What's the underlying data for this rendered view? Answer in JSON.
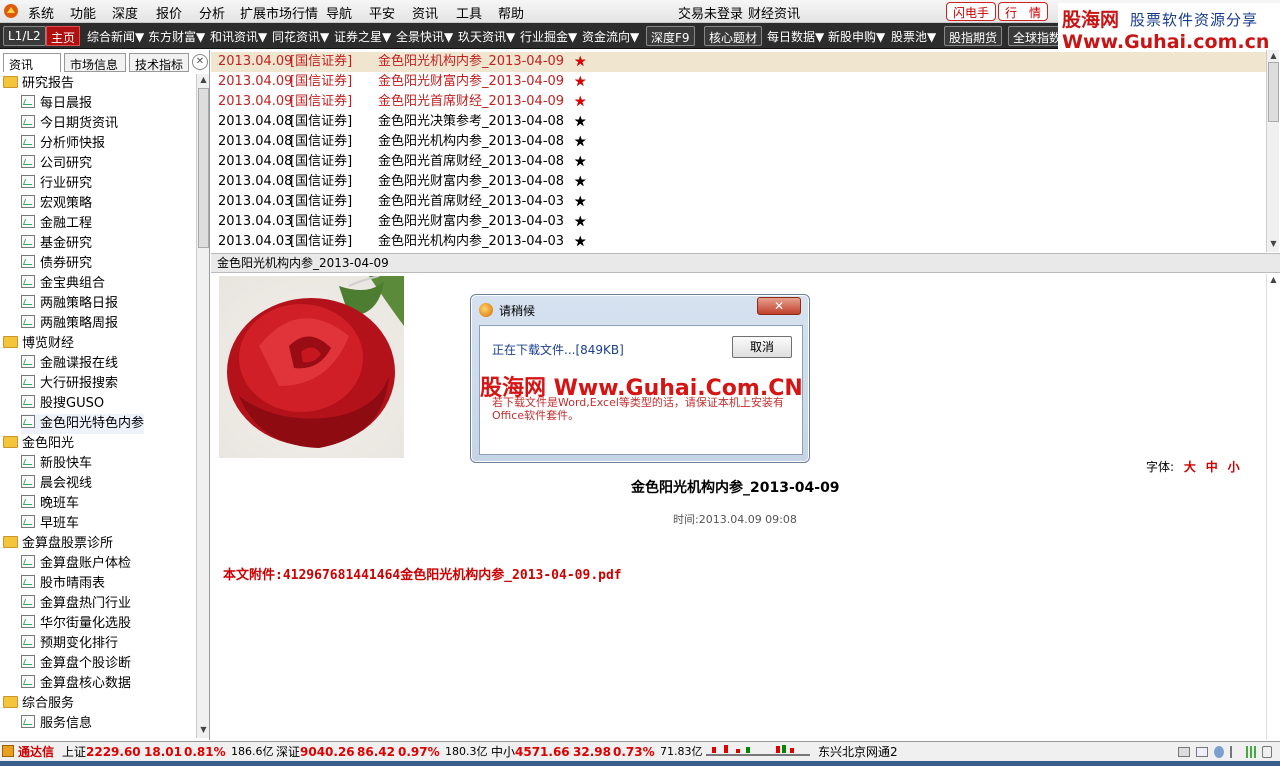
{
  "menubar": {
    "items": [
      "系统",
      "功能",
      "深度",
      "报价",
      "分析",
      "扩展市场行情",
      "导航",
      "平安",
      "资讯",
      "工具",
      "帮助"
    ],
    "trade_status": "交易未登录",
    "finance_news": "财经资讯",
    "flash_btn": "闪电手",
    "quote_btn": "行　情"
  },
  "toolbar": {
    "l1l2": "L1/L2",
    "home": "主页",
    "items": [
      "综合新闻▼",
      "东方财富▼",
      "和讯资讯▼",
      "同花资讯▼",
      "证券之星▼",
      "全景快讯▼",
      "玖天资讯▼",
      "行业掘金▼",
      "资金流向▼"
    ],
    "depth": "深度F9",
    "core": "核心题材",
    "daily": "每日数据▼",
    "ipo": "新股申购▼",
    "pool": "股票池▼",
    "futures": "股指期货",
    "global": "全球指数"
  },
  "watermark_logo": {
    "line1": "股海网",
    "line1b": "股票软件资源分享",
    "line2": "Www.Guhai.com.cn"
  },
  "left_tabs": [
    "资讯",
    "市场信息",
    "技术指标"
  ],
  "left_close": "✕",
  "tree": [
    {
      "type": "folder",
      "label": "研究报告"
    },
    {
      "type": "leaf",
      "label": "每日晨报"
    },
    {
      "type": "leaf",
      "label": "今日期货资讯"
    },
    {
      "type": "leaf",
      "label": "分析师快报"
    },
    {
      "type": "leaf",
      "label": "公司研究"
    },
    {
      "type": "leaf",
      "label": "行业研究"
    },
    {
      "type": "leaf",
      "label": "宏观策略"
    },
    {
      "type": "leaf",
      "label": "金融工程"
    },
    {
      "type": "leaf",
      "label": "基金研究"
    },
    {
      "type": "leaf",
      "label": "债券研究"
    },
    {
      "type": "leaf",
      "label": "金宝典组合"
    },
    {
      "type": "leaf",
      "label": "两融策略日报"
    },
    {
      "type": "leaf",
      "label": "两融策略周报"
    },
    {
      "type": "folder",
      "label": "博览财经"
    },
    {
      "type": "leaf",
      "label": "金融谍报在线"
    },
    {
      "type": "leaf",
      "label": "大行研报搜索"
    },
    {
      "type": "leaf",
      "label": "股搜GUSO"
    },
    {
      "type": "leaf",
      "label": "金色阳光特色内参",
      "selected": true
    },
    {
      "type": "folder",
      "label": "金色阳光"
    },
    {
      "type": "leaf",
      "label": "新股快车"
    },
    {
      "type": "leaf",
      "label": "晨会视线"
    },
    {
      "type": "leaf",
      "label": "晚班车"
    },
    {
      "type": "leaf",
      "label": "早班车"
    },
    {
      "type": "folder",
      "label": "金算盘股票诊所"
    },
    {
      "type": "leaf",
      "label": "金算盘账户体检"
    },
    {
      "type": "leaf",
      "label": "股市晴雨表"
    },
    {
      "type": "leaf",
      "label": "金算盘热门行业"
    },
    {
      "type": "leaf",
      "label": "华尔街量化选股"
    },
    {
      "type": "leaf",
      "label": "预期变化排行"
    },
    {
      "type": "leaf",
      "label": "金算盘个股诊断"
    },
    {
      "type": "leaf",
      "label": "金算盘核心数据"
    },
    {
      "type": "folder",
      "label": "综合服务"
    },
    {
      "type": "leaf",
      "label": "服务信息"
    }
  ],
  "news": [
    {
      "date": "2013.04.09",
      "source": "[国信证券]",
      "title": "金色阳光机构内参_2013-04-09",
      "stars": "★☆☆☆☆",
      "red": true,
      "selected": true
    },
    {
      "date": "2013.04.09",
      "source": "[国信证券]",
      "title": "金色阳光财富内参_2013-04-09",
      "stars": "★☆☆☆☆",
      "red": true
    },
    {
      "date": "2013.04.09",
      "source": "[国信证券]",
      "title": "金色阳光首席财经_2013-04-09",
      "stars": "★☆☆☆☆",
      "red": true
    },
    {
      "date": "2013.04.08",
      "source": "[国信证券]",
      "title": "金色阳光决策参考_2013-04-08",
      "stars": "★☆☆☆☆"
    },
    {
      "date": "2013.04.08",
      "source": "[国信证券]",
      "title": "金色阳光机构内参_2013-04-08",
      "stars": "★☆☆☆☆"
    },
    {
      "date": "2013.04.08",
      "source": "[国信证券]",
      "title": "金色阳光首席财经_2013-04-08",
      "stars": "★☆☆☆☆"
    },
    {
      "date": "2013.04.08",
      "source": "[国信证券]",
      "title": "金色阳光财富内参_2013-04-08",
      "stars": "★☆☆☆☆"
    },
    {
      "date": "2013.04.03",
      "source": "[国信证券]",
      "title": "金色阳光首席财经_2013-04-03",
      "stars": "★☆☆☆☆"
    },
    {
      "date": "2013.04.03",
      "source": "[国信证券]",
      "title": "金色阳光财富内参_2013-04-03",
      "stars": "★☆☆☆☆"
    },
    {
      "date": "2013.04.03",
      "source": "[国信证券]",
      "title": "金色阳光机构内参_2013-04-03",
      "stars": "★☆☆☆☆"
    }
  ],
  "article": {
    "header": "金色阳光机构内参_2013-04-09",
    "font_label": "字体:",
    "font_sizes": [
      "大",
      "中",
      "小"
    ],
    "title": "金色阳光机构内参_2013-04-09",
    "time": "时间:2013.04.09 09:08",
    "attachment": "本文附件:412967681441464金色阳光机构内参_2013-04-09.pdf"
  },
  "dialog": {
    "title": "请稍候",
    "close": "✕",
    "message": "正在下载文件...[849KB]",
    "cancel": "取消",
    "note": "若下载文件是Word,Excel等类型的话，请保证本机上安装有Office软件套件。",
    "watermark": "股海网 Www.Guhai.Com.CN"
  },
  "statusbar": {
    "app": "通达信",
    "sh_label": "上证",
    "sh_value": "2229.60",
    "sh_change": "18.01",
    "sh_pct": "0.81%",
    "sh_vol": "186.6亿",
    "sz_label": "深证",
    "sz_value": "9040.26",
    "sz_change": "86.42",
    "sz_pct": "0.97%",
    "sz_vol": "180.3亿",
    "zx_label": "中小",
    "zx_value": "4571.66",
    "zx_change": "32.98",
    "zx_pct": "0.73%",
    "zx_vol": "71.83亿",
    "server": "东兴北京网通2"
  },
  "colors": {
    "up": "#dd0000",
    "toolbar": "#2c2c2c",
    "selected_row": "#f0e6cf",
    "accent": "#c81414"
  }
}
